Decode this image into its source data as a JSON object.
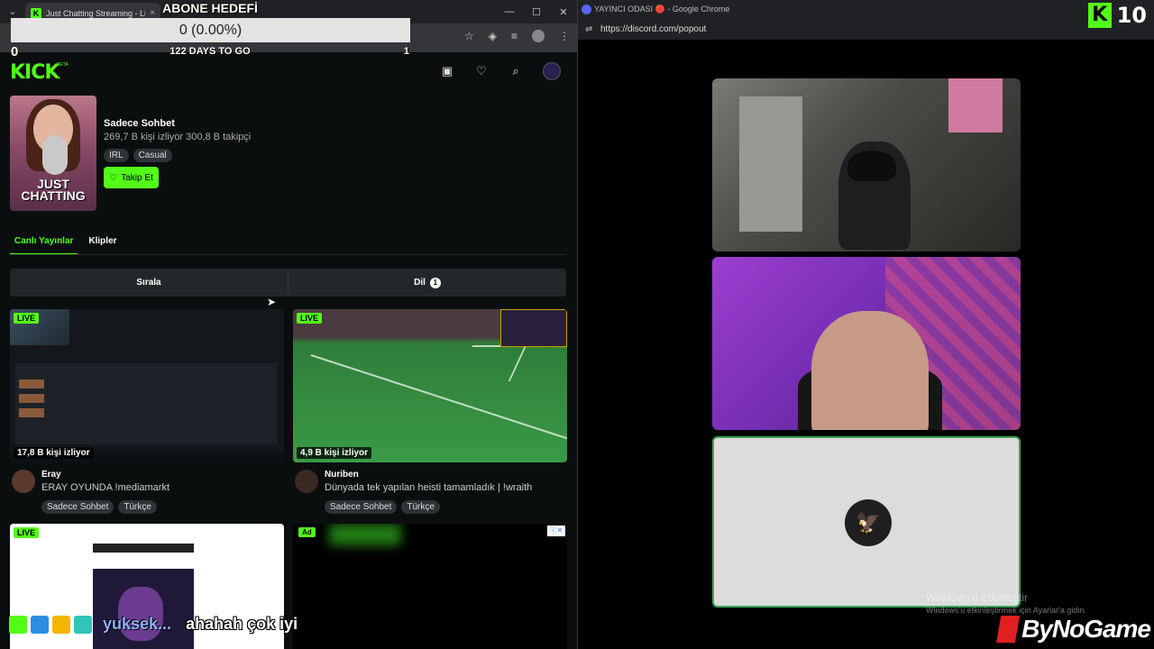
{
  "left_window": {
    "tab_title": "Just Chatting Streaming - Live",
    "tab_close": "×",
    "window_buttons": [
      "—",
      "☐",
      "✕"
    ]
  },
  "goal_overlay": {
    "title": "ABONE HEDEFİ",
    "progress": "0 (0.00%)",
    "progress_fraction": 0.0,
    "min": "0",
    "days_left": "122 DAYS TO GO",
    "max": "1"
  },
  "kick": {
    "logo": "KICK",
    "beta": "BETA",
    "category": {
      "name": "Sadece Sohbet",
      "stats": "269,7 B kişi izliyor  300,8 B takipçi",
      "tags": [
        "IRL",
        "Casual"
      ],
      "follow_label": "Takip Et",
      "thumb_label": "JUST CHATTING"
    },
    "tabs": {
      "live": "Canlı Yayınlar",
      "clips": "Klipler"
    },
    "filters": {
      "sort": "Sırala",
      "language": "Dil",
      "language_count": "1"
    },
    "streams": [
      {
        "live": "LIVE",
        "viewers": "17,8 B kişi izliyor",
        "name": "Eray",
        "title": "ERAY OYUNDA !mediamarkt",
        "tags": [
          "Sadece Sohbet",
          "Türkçe"
        ]
      },
      {
        "live": "LIVE",
        "viewers": "4,9 B kişi izliyor",
        "name": "Nuriben",
        "title": "Dünyada tek yapılan heisti tamamladık | !wraith",
        "tags": [
          "Sadece Sohbet",
          "Türkçe"
        ]
      },
      {
        "live": "LIVE"
      },
      {
        "ad": "Ad"
      }
    ]
  },
  "chat_overlay": {
    "user": "yuksek...",
    "message": "ahahah çok iyi"
  },
  "right_window": {
    "title": "YAYINCI ODASI 🔴 - Google Chrome",
    "url": "https://discord.com/popout"
  },
  "kick_counter": {
    "logo": "K",
    "value": "10"
  },
  "windows_watermark": {
    "line1": "Windows'u Etkinleştir",
    "line2": "Windows'u etkinleştirmek için Ayarlar'a gidin."
  },
  "sponsor": "ByNoGame"
}
